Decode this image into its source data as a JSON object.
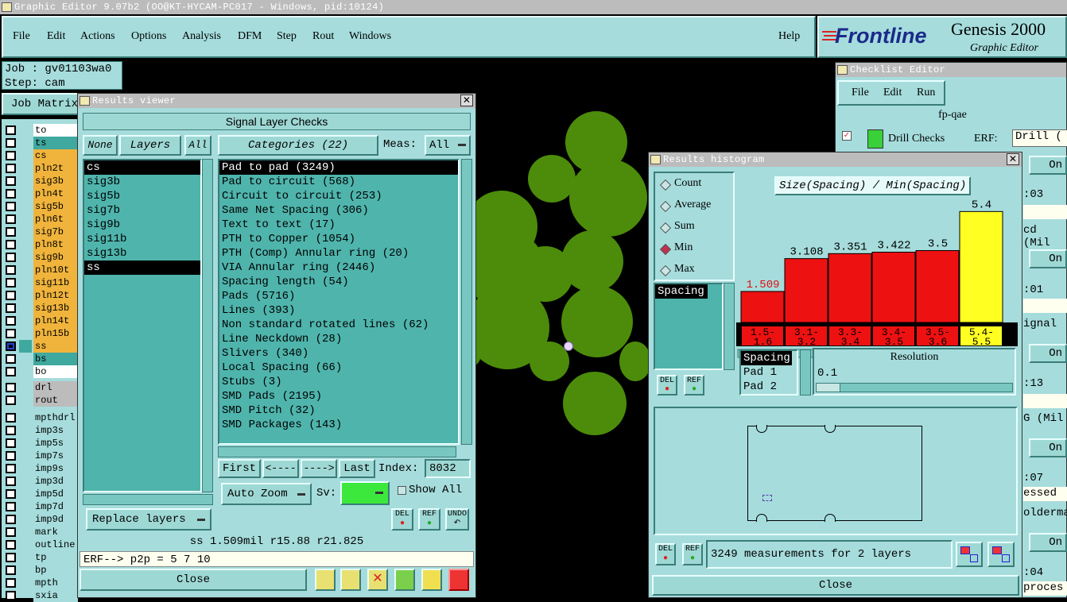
{
  "app": {
    "title": "Graphic Editor 9.07b2 (OO@KT-HYCAM-PC017 - Windows, pid:10124)"
  },
  "menu": {
    "items": [
      "File",
      "Edit",
      "Actions",
      "Options",
      "Analysis",
      "DFM",
      "Step",
      "Rout",
      "Windows"
    ],
    "help": "Help"
  },
  "brand": {
    "logo": "Frontline",
    "product": "Genesis 2000",
    "subtitle": "Graphic Editor"
  },
  "job": {
    "job_label": "Job : gv01103wa0",
    "step_label": "Step: cam",
    "matrix_button": "Job Matrix"
  },
  "layers": {
    "group1": [
      {
        "name": "to",
        "color": "#ffffff",
        "checked": false
      },
      {
        "name": "ts",
        "color": "#3fa89f",
        "checked": false
      },
      {
        "name": "cs",
        "color": "#f0b43c",
        "checked": false
      },
      {
        "name": "pln2t",
        "color": "#f0b43c",
        "checked": false
      },
      {
        "name": "sig3b",
        "color": "#f0b43c",
        "checked": false
      },
      {
        "name": "pln4t",
        "color": "#f0b43c",
        "checked": false
      },
      {
        "name": "sig5b",
        "color": "#f0b43c",
        "checked": false
      },
      {
        "name": "pln6t",
        "color": "#f0b43c",
        "checked": false
      },
      {
        "name": "sig7b",
        "color": "#f0b43c",
        "checked": false
      },
      {
        "name": "pln8t",
        "color": "#f0b43c",
        "checked": false
      },
      {
        "name": "sig9b",
        "color": "#f0b43c",
        "checked": false
      },
      {
        "name": "pln10t",
        "color": "#f0b43c",
        "checked": false
      },
      {
        "name": "sig11b",
        "color": "#f0b43c",
        "checked": false
      },
      {
        "name": "pln12t",
        "color": "#f0b43c",
        "checked": false
      },
      {
        "name": "sig13b",
        "color": "#f0b43c",
        "checked": false
      },
      {
        "name": "pln14t",
        "color": "#f0b43c",
        "checked": false
      },
      {
        "name": "pln15b",
        "color": "#f0b43c",
        "checked": false
      },
      {
        "name": "ss",
        "color": "#f0b43c",
        "checked": true
      },
      {
        "name": "bs",
        "color": "#3fa89f",
        "checked": false
      },
      {
        "name": "bo",
        "color": "#ffffff",
        "checked": false
      }
    ],
    "group2": [
      {
        "name": "drl",
        "color": "#bcbcbc",
        "checked": false
      },
      {
        "name": "rout",
        "color": "#bcbcbc",
        "checked": false
      }
    ],
    "group3": [
      {
        "name": "mpthdrl",
        "color": "#a6dcdc",
        "checked": false
      },
      {
        "name": "imp3s",
        "color": "#a6dcdc",
        "checked": false
      },
      {
        "name": "imp5s",
        "color": "#a6dcdc",
        "checked": false
      },
      {
        "name": "imp7s",
        "color": "#a6dcdc",
        "checked": false
      },
      {
        "name": "imp9s",
        "color": "#a6dcdc",
        "checked": false
      },
      {
        "name": "imp3d",
        "color": "#a6dcdc",
        "checked": false
      },
      {
        "name": "imp5d",
        "color": "#a6dcdc",
        "checked": false
      },
      {
        "name": "imp7d",
        "color": "#a6dcdc",
        "checked": false
      },
      {
        "name": "imp9d",
        "color": "#a6dcdc",
        "checked": false
      },
      {
        "name": "mark",
        "color": "#a6dcdc",
        "checked": false
      },
      {
        "name": "outline",
        "color": "#a6dcdc",
        "checked": false
      },
      {
        "name": "tp",
        "color": "#a6dcdc",
        "checked": false
      },
      {
        "name": "bp",
        "color": "#a6dcdc",
        "checked": false
      },
      {
        "name": "mpth",
        "color": "#a6dcdc",
        "checked": false
      },
      {
        "name": "sxia",
        "color": "#a6dcdc",
        "checked": false
      }
    ]
  },
  "results_viewer": {
    "title": "Results viewer",
    "heading": "Signal Layer Checks",
    "none_btn": "None",
    "layers_btn": "Layers",
    "all_btn": "All",
    "categories_btn": "Categories (22)",
    "meas_label": "Meas:",
    "meas_value": "All",
    "layer_list": [
      "cs",
      "sig3b",
      "sig5b",
      "sig7b",
      "sig9b",
      "sig11b",
      "sig13b",
      "ss"
    ],
    "categories": [
      "Pad to pad (3249)",
      "Pad to circuit (568)",
      "Circuit to circuit (253)",
      "Same Net Spacing (306)",
      "Text to text (17)",
      "PTH to Copper (1054)",
      "PTH (Comp) Annular ring (20)",
      "VIA Annular ring (2446)",
      "Spacing length (54)",
      "Pads (5716)",
      "Lines (393)",
      "Non standard rotated lines (62)",
      "Line Neckdown (28)",
      "Slivers (340)",
      "Local Spacing (66)",
      "Stubs (3)",
      "SMD Pads (2195)",
      "SMD Pitch (32)",
      "SMD Packages (143)"
    ],
    "first_btn": "First",
    "prev_btn": "<----",
    "next_btn": "---->",
    "last_btn": "Last",
    "index_label": "Index:",
    "index_value": "8032",
    "auto_zoom": "Auto Zoom",
    "sv_label": "Sv:",
    "show_all": "Show All",
    "replace_layers": "Replace layers",
    "del_btn": "DEL",
    "ref_btn": "REF",
    "undo_btn": "UNDO",
    "status_line": "ss 1.509mil  r15.88  r21.825",
    "erf_line": "ERF--> p2p = 5 7 10",
    "close_btn": "Close"
  },
  "histogram": {
    "title": "Results histogram",
    "options": [
      "Count",
      "Average",
      "Sum",
      "Min",
      "Max"
    ],
    "selected_option": "Min",
    "heading": "Size(Spacing) / Min(Spacing)",
    "spacing_list": [
      "Spacing"
    ],
    "spacing_list2": [
      "Spacing",
      "Pad 1",
      "Pad 2"
    ],
    "resolution_label": "Resolution",
    "resolution_value": "0.1",
    "del_btn": "DEL",
    "ref_btn": "REF",
    "status": "3249 measurements for 2 layers",
    "close_btn": "Close"
  },
  "chart_data": {
    "type": "bar",
    "title": "Size(Spacing) / Min(Spacing)",
    "categories": [
      "1.5-1.6",
      "3.1-3.2",
      "3.3-3.4",
      "3.4-3.5",
      "3.5-3.6",
      "5.4-5.5"
    ],
    "category_lines": [
      [
        "1.5-",
        "1.6"
      ],
      [
        "3.1-",
        "3.2"
      ],
      [
        "3.3-",
        "3.4"
      ],
      [
        "3.4-",
        "3.5"
      ],
      [
        "3.5-",
        "3.6"
      ],
      [
        "5.4-",
        "5.5"
      ]
    ],
    "values": [
      1.509,
      3.108,
      3.351,
      3.422,
      3.5,
      5.4
    ],
    "labels": [
      "1.509",
      "3.108",
      "3.351",
      "3.422",
      "3.5",
      "5.4"
    ],
    "colors": [
      "#ee1111",
      "#ee1111",
      "#ee1111",
      "#ee1111",
      "#ee1111",
      "#ffff22"
    ],
    "ylim": [
      0,
      5.8
    ]
  },
  "checklist": {
    "title": "Checklist Editor",
    "menu": [
      "File",
      "Edit",
      "Run"
    ],
    "name": "fp-qae",
    "drill_checks": "Drill Checks",
    "erf_label": "ERF:",
    "erf_value": "Drill (",
    "on": "On",
    "times": [
      ":03",
      ":01",
      ":13",
      ":07",
      ":04"
    ],
    "frags": [
      "cd (Mil",
      "ignal",
      "G (Mil",
      "essed",
      "olderma",
      "proces"
    ]
  }
}
